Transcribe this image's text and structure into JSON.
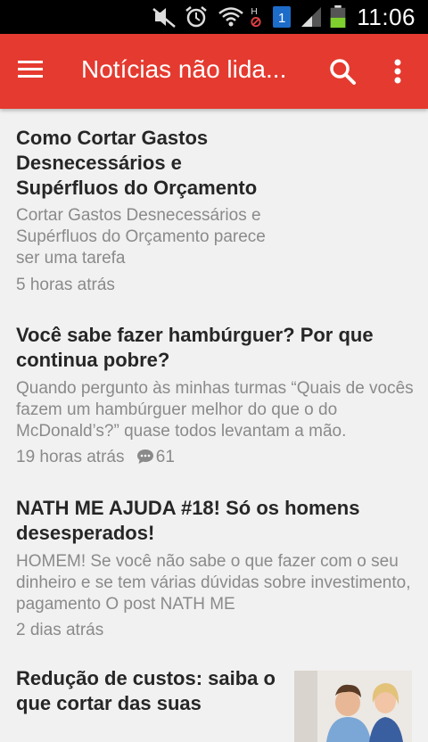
{
  "status_bar": {
    "time": "11:06"
  },
  "app_bar": {
    "title": "Notícias não lida..."
  },
  "articles": [
    {
      "title": "Como Cortar Gastos Desnecessários e Supérfluos do Orçamento",
      "snippet": "Cortar Gastos Desnecessários e Supérfluos do Orçamento parece ser uma tarefa",
      "time": "5 horas atrás"
    },
    {
      "title": "Você sabe fazer hambúrguer? Por que continua pobre?",
      "snippet": "Quando pergunto às minhas turmas “Quais de vocês fazem um hambúrguer melhor do que o do McDonald’s?” quase todos levantam a mão.",
      "time": "19 horas atrás",
      "comments": "61"
    },
    {
      "title": "NATH ME AJUDA #18!  Só os homens desesperados!",
      "snippet": "HOMEM! Se você não sabe o que fazer com o seu dinheiro e se tem várias dúvidas sobre investimento, pagamento O post NATH ME",
      "time": "2 dias atrás"
    },
    {
      "title": "Redução de custos: saiba o que cortar das suas"
    }
  ],
  "colors": {
    "accent": "#e53a2f",
    "background": "#f1f1f1"
  }
}
